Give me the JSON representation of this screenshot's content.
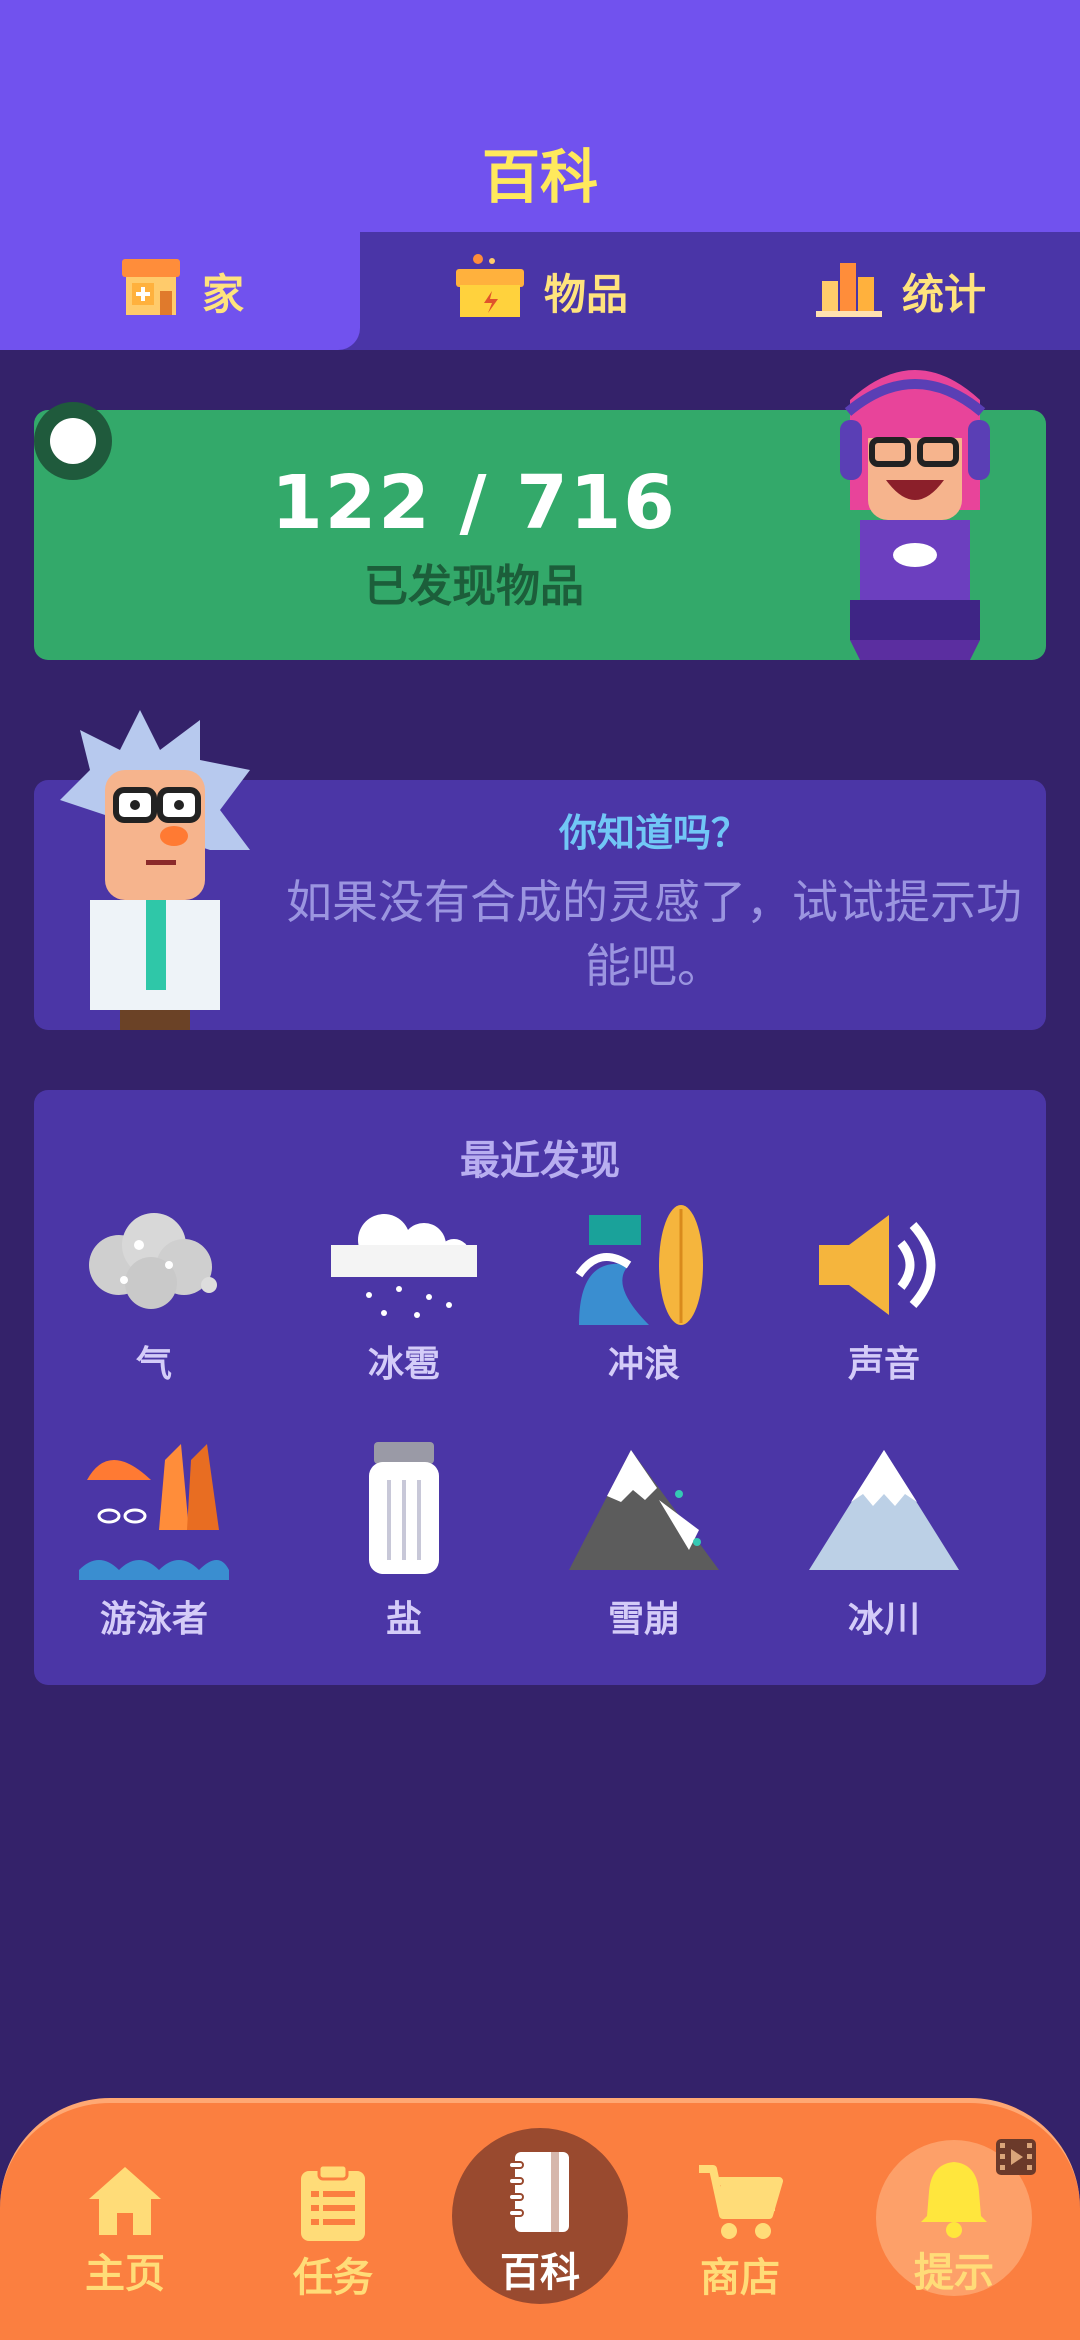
{
  "header": {
    "title": "百科"
  },
  "tabs": [
    {
      "label": "家",
      "icon": "shop-icon",
      "active": true
    },
    {
      "label": "物品",
      "icon": "box-icon",
      "active": false
    },
    {
      "label": "统计",
      "icon": "bar-chart-icon",
      "active": false
    }
  ],
  "discover": {
    "count": "122  /  716",
    "label": "已发现物品"
  },
  "tip": {
    "title": "你知道吗？",
    "text": "如果没有合成的灵感了，试试提示功能吧。"
  },
  "recent": {
    "title": "最近发现",
    "items": [
      {
        "label": "气",
        "icon": "steam-icon"
      },
      {
        "label": "冰雹",
        "icon": "hail-icon"
      },
      {
        "label": "冲浪",
        "icon": "surfing-icon"
      },
      {
        "label": "声音",
        "icon": "sound-icon"
      },
      {
        "label": "游泳者",
        "icon": "swimmer-icon"
      },
      {
        "label": "盐",
        "icon": "salt-icon"
      },
      {
        "label": "雪崩",
        "icon": "avalanche-icon"
      },
      {
        "label": "冰川",
        "icon": "glacier-icon"
      }
    ]
  },
  "nav": [
    {
      "label": "主页",
      "icon": "home-icon"
    },
    {
      "label": "任务",
      "icon": "clipboard-icon"
    },
    {
      "label": "百科",
      "icon": "notebook-icon",
      "active": true
    },
    {
      "label": "商店",
      "icon": "cart-icon"
    },
    {
      "label": "提示",
      "icon": "bell-icon"
    }
  ],
  "colors": {
    "accent": "#7152ee",
    "background": "#34226a",
    "green": "#33a96a",
    "nav": "#fb7f40",
    "yellow": "#ffe95c"
  }
}
